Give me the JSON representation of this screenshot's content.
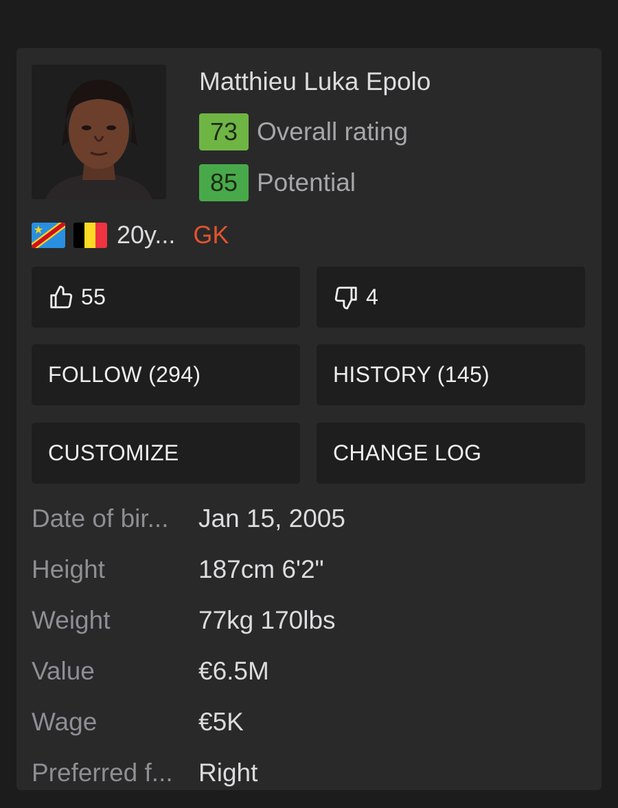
{
  "player": {
    "name": "Matthieu Luka Epolo",
    "overall": "73",
    "overall_label": "Overall rating",
    "potential": "85",
    "potential_label": "Potential",
    "age": "20y...",
    "position": "GK",
    "nationalities": [
      "DR Congo",
      "Belgium"
    ]
  },
  "actions": {
    "likes": "55",
    "dislikes": "4",
    "follow": "FOLLOW (294)",
    "history": "HISTORY (145)",
    "customize": "CUSTOMIZE",
    "change_log": "CHANGE LOG"
  },
  "info": [
    {
      "label": "Date of bir...",
      "value": "Jan 15, 2005"
    },
    {
      "label": "Height",
      "value": "187cm 6'2\""
    },
    {
      "label": "Weight",
      "value": "77kg 170lbs"
    },
    {
      "label": "Value",
      "value": "€6.5M"
    },
    {
      "label": "Wage",
      "value": "€5K"
    },
    {
      "label": "Preferred f...",
      "value": "Right"
    }
  ],
  "colors": {
    "overall_badge": "#6fb544",
    "potential_badge": "#48a94a",
    "position": "#e2532d",
    "card_bg": "#29292a",
    "button_bg": "#1e1e1f"
  },
  "icons": [
    "thumbs-up-icon",
    "thumbs-down-icon"
  ]
}
